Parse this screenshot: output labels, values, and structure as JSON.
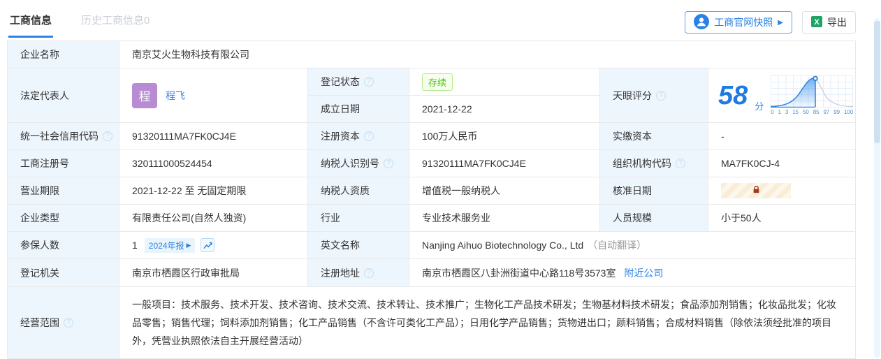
{
  "tabs": {
    "business": "工商信息",
    "history": "历史工商信息0"
  },
  "toolbar": {
    "snapshot": "工商官网快照",
    "export": "导出"
  },
  "table": {
    "company_name": {
      "label": "企业名称",
      "value": "南京艾火生物科技有限公司"
    },
    "legal_rep": {
      "label": "法定代表人",
      "avatar": "程",
      "name": "程飞"
    },
    "reg_status": {
      "label": "登记状态",
      "badge": "存续"
    },
    "establish_date": {
      "label": "成立日期",
      "value": "2021-12-22"
    },
    "score": {
      "label": "天眼评分",
      "value": "58",
      "unit": "分"
    },
    "credit_code": {
      "label": "统一社会信用代码",
      "value": "91320111MA7FK0CJ4E"
    },
    "reg_capital": {
      "label": "注册资本",
      "value": "100万人民币"
    },
    "paid_capital": {
      "label": "实缴资本",
      "value": "-"
    },
    "reg_no": {
      "label": "工商注册号",
      "value": "320111000524454"
    },
    "taxpayer_no": {
      "label": "纳税人识别号",
      "value": "91320111MA7FK0CJ4E"
    },
    "org_code": {
      "label": "组织机构代码",
      "value": "MA7FK0CJ-4"
    },
    "term": {
      "label": "营业期限",
      "value": "2021-12-22 至 无固定期限"
    },
    "taxpayer_quality": {
      "label": "纳税人资质",
      "value": "增值税一般纳税人"
    },
    "approval_date": {
      "label": "核准日期"
    },
    "company_type": {
      "label": "企业类型",
      "value": "有限责任公司(自然人独资)"
    },
    "industry": {
      "label": "行业",
      "value": "专业技术服务业"
    },
    "staff": {
      "label": "人员规模",
      "value": "小于50人"
    },
    "insured": {
      "label": "参保人数",
      "value": "1",
      "chip": "2024年报"
    },
    "en_name": {
      "label": "英文名称",
      "value": "Nanjing Aihuo Biotechnology Co., Ltd",
      "note": "（自动翻译）"
    },
    "authority": {
      "label": "登记机关",
      "value": "南京市栖霞区行政审批局"
    },
    "address": {
      "label": "注册地址",
      "value": "南京市栖霞区八卦洲街道中心路118号3573室",
      "link": "附近公司"
    },
    "scope": {
      "label": "经营范围",
      "value": "一般项目：技术服务、技术开发、技术咨询、技术交流、技术转让、技术推广；生物化工产品技术研发；生物基材料技术研发；食品添加剂销售；化妆品批发；化妆品零售；销售代理；饲料添加剂销售；化工产品销售（不含许可类化工产品）；日用化学产品销售；货物进出口；颜料销售；合成材料销售（除依法须经批准的项目外，凭营业执照依法自主开展经营活动）"
    }
  },
  "chart_data": {
    "type": "area",
    "title": "天眼评分分布曲线",
    "score": 58,
    "x_ticks": [
      0,
      1,
      3,
      15,
      50,
      85,
      97,
      99,
      100
    ],
    "marker_value": 58,
    "legend_position": "none",
    "grid": true
  },
  "colors": {
    "accent": "#2a82e4",
    "badge_green": "#52c41a",
    "avatar_purple": "#b78cd2",
    "lock_red": "#a23b17",
    "label_bg": "#eef6fd"
  }
}
